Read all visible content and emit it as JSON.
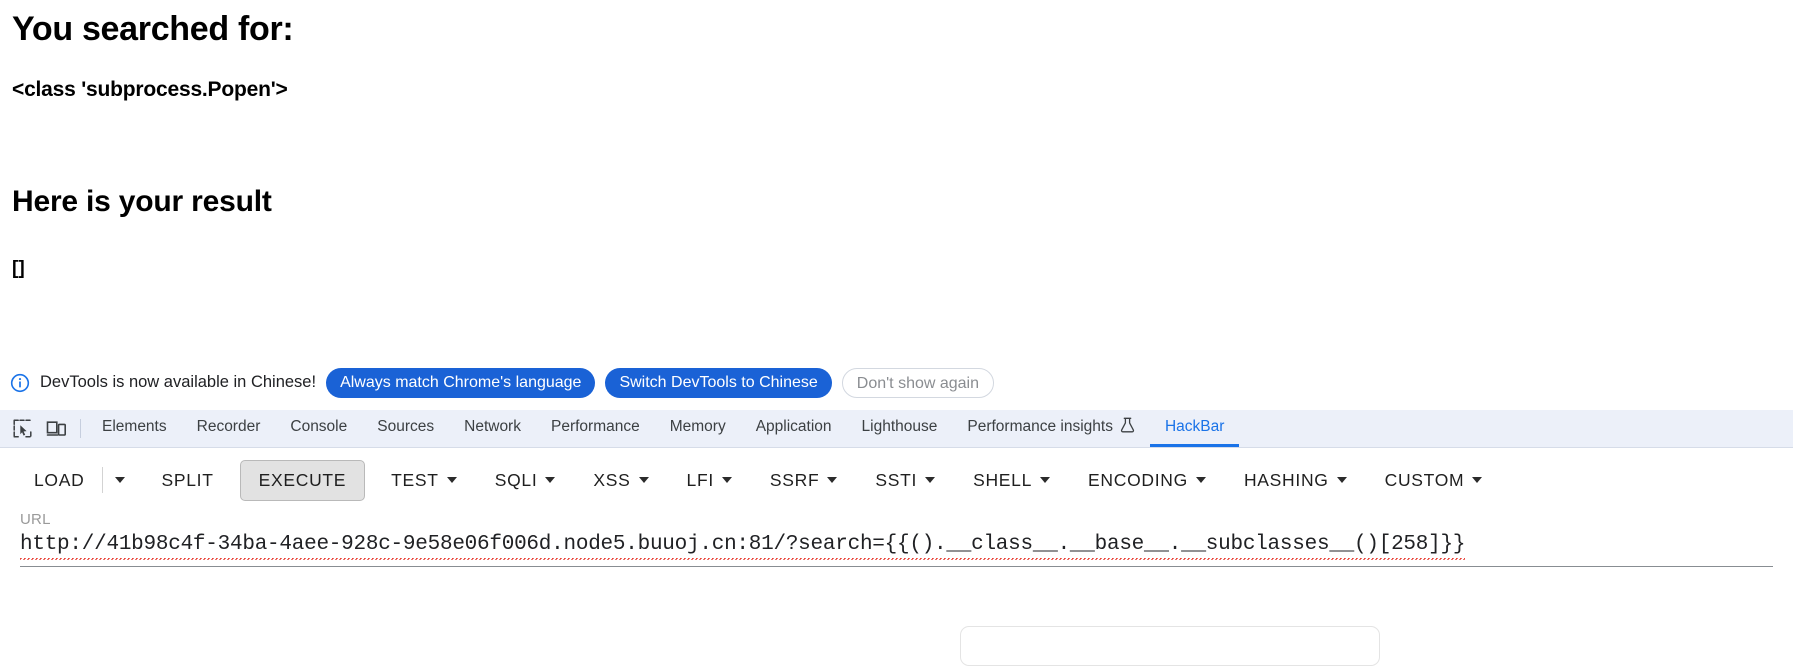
{
  "page": {
    "searched_heading": "You searched for:",
    "searched_value": "<class 'subprocess.Popen'>",
    "result_heading": "Here is your result",
    "result_value": "[]"
  },
  "notification": {
    "icon": "info-circle-icon",
    "message": "DevTools is now available in Chinese!",
    "always_match_label": "Always match Chrome's language",
    "switch_label": "Switch DevTools to Chinese",
    "dismiss_label": "Don't show again",
    "primary_color": "#1a62d6",
    "dismiss_text_color": "#8a8d91"
  },
  "devtools": {
    "inspect_icon": "inspect-element-icon",
    "device_icon": "device-toolbar-icon",
    "active_tab": "HackBar",
    "active_color": "#1a73e8",
    "tabbar_background": "#ecf0f9",
    "tabs": [
      {
        "label": "Elements",
        "icon": null
      },
      {
        "label": "Recorder",
        "icon": null
      },
      {
        "label": "Console",
        "icon": null
      },
      {
        "label": "Sources",
        "icon": null
      },
      {
        "label": "Network",
        "icon": null
      },
      {
        "label": "Performance",
        "icon": null
      },
      {
        "label": "Memory",
        "icon": null
      },
      {
        "label": "Application",
        "icon": null
      },
      {
        "label": "Lighthouse",
        "icon": null
      },
      {
        "label": "Performance insights",
        "icon": "flask-icon"
      },
      {
        "label": "HackBar",
        "icon": null
      }
    ]
  },
  "hackbar": {
    "load_label": "LOAD",
    "load_caret": "chevron-down-icon",
    "split_label": "SPLIT",
    "execute_label": "EXECUTE",
    "execute_pressed": true,
    "menus": [
      {
        "label": "TEST"
      },
      {
        "label": "SQLI"
      },
      {
        "label": "XSS"
      },
      {
        "label": "LFI"
      },
      {
        "label": "SSRF"
      },
      {
        "label": "SSTI"
      },
      {
        "label": "SHELL"
      },
      {
        "label": "ENCODING"
      },
      {
        "label": "HASHING"
      },
      {
        "label": "CUSTOM"
      }
    ],
    "url_label": "URL",
    "url_value": "http://41b98c4f-34ba-4aee-928c-9e58e06f006d.node5.buuoj.cn:81/?search={{().__class__.__base__.__subclasses__()[258]}}"
  }
}
